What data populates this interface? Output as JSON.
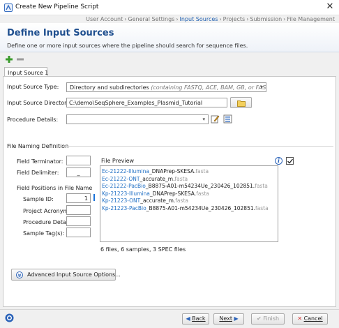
{
  "window": {
    "title": "Create New Pipeline Script",
    "close_glyph": "✕",
    "breadcrumbs": [
      {
        "label": "User Account",
        "active": false
      },
      {
        "label": "General Settings",
        "active": false
      },
      {
        "label": "Input Sources",
        "active": true
      },
      {
        "label": "Projects",
        "active": false
      },
      {
        "label": "Submission",
        "active": false
      },
      {
        "label": "File Management",
        "active": false
      }
    ],
    "breadcrumb_sep": "›"
  },
  "header": {
    "title": "Define Input Sources",
    "subtitle": "Define one or more input sources where the pipeline should search for sequence files."
  },
  "tabs": [
    {
      "label": "Input Source 1",
      "active": true
    }
  ],
  "form": {
    "type_label": "Input Source Type:",
    "type_value": "Directory and subdirectories",
    "type_hint": "(containing FASTQ, ACE, BAM, GB, or FASTA files)",
    "dir_label": "Input Source Directory:",
    "dir_value": "C:\\demo\\SeqSphere_Examples_Plasmid_Tutorial",
    "proc_label": "Procedure Details:",
    "proc_value": ""
  },
  "naming": {
    "section_title": "File Naming Definition",
    "terminator_label": "Field Terminator:",
    "terminator_value": "",
    "delimiter_label": "Field Delimiter:",
    "delimiter_value": "_",
    "positions_title": "Field Positions in File Name",
    "sample_id_label": "Sample ID:",
    "sample_id_value": "1",
    "project_label": "Project Acronym:",
    "project_value": "",
    "procedure_label": "Procedure Details:",
    "procedure_value": "",
    "tags_label": "Sample Tag(s):",
    "tags_value": ""
  },
  "preview": {
    "title": "File Preview",
    "info_glyph": "i",
    "checked": true,
    "files": [
      {
        "prefix": "Ec-21222-Illumina",
        "rest": "_DNAPrep-SKESA.",
        "ext": "fasta"
      },
      {
        "prefix": "Ec-21222-ONT",
        "rest": "_accurate_m.",
        "ext": "fasta"
      },
      {
        "prefix": "Ec-21222-PacBio",
        "rest": "_B8875-A01-m54234Ue_230426_102851.",
        "ext": "fasta"
      },
      {
        "prefix": "Kp-21223-Illumina",
        "rest": "_DNAPrep-SKESA.",
        "ext": "fasta"
      },
      {
        "prefix": "Kp-21223-ONT",
        "rest": "_accurate_m.",
        "ext": "fasta"
      },
      {
        "prefix": "Kp-21223-PacBio",
        "rest": "_B8875-A01-m54234Ue_230426_102851.",
        "ext": "fasta"
      }
    ],
    "summary": "6 files, 6 samples, 3 SPEC files"
  },
  "advanced_button": "Advanced Input Source Options...",
  "footer": {
    "back": "Back",
    "next": "Next",
    "finish": "Finish",
    "cancel": "Cancel"
  },
  "colors": {
    "accent": "#1f4f8f",
    "link_blue": "#1f6fc4",
    "active_crumb": "#1f5fb0",
    "add_green": "#3a9b2b",
    "cancel_red": "#d23030"
  },
  "icons": [
    "app-icon",
    "close-icon",
    "add-icon",
    "remove-icon",
    "dropdown-arrow-icon",
    "folder-icon",
    "edit-icon",
    "list-icon",
    "info-icon",
    "checkbox-icon",
    "expand-icon",
    "help-icon",
    "back-arrow-icon",
    "next-arrow-icon",
    "finish-icon",
    "cancel-icon"
  ]
}
